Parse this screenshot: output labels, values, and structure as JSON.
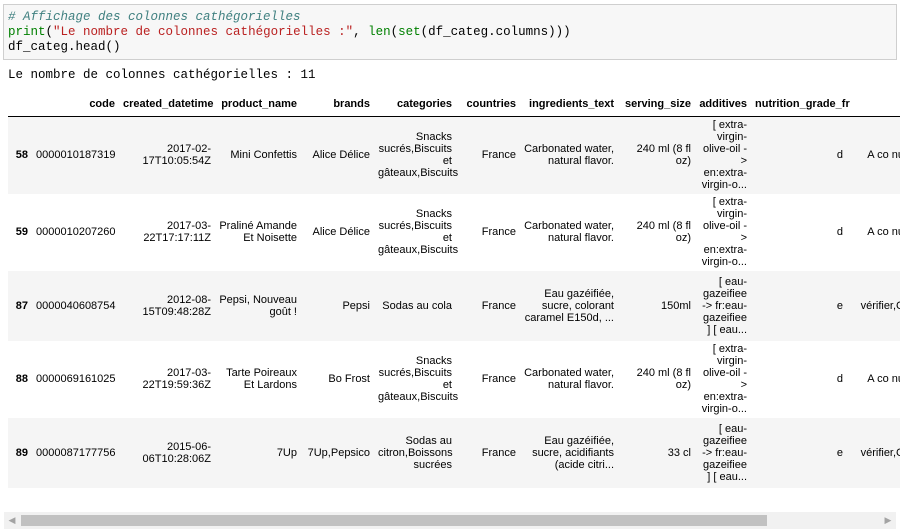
{
  "code_cell": {
    "line1_comment": "# Affichage des colonnes cathégorielles",
    "line2_print": "print",
    "line2_open": "(",
    "line2_string": "\"Le nombre de colonnes cathégorielles :\"",
    "line2_mid": ", ",
    "line2_len": "len",
    "line2_paren": "(",
    "line2_set": "set",
    "line2_rest": "(df_categ.columns)))",
    "line3": "df_categ.head()"
  },
  "output_text": "Le nombre de colonnes cathégorielles : 11",
  "table": {
    "columns": [
      "code",
      "created_datetime",
      "product_name",
      "brands",
      "categories",
      "countries",
      "ingredients_text",
      "serving_size",
      "additives",
      "nutrition_grade_fr"
    ],
    "rows": [
      {
        "index": "58",
        "code": "0000010187319",
        "created_datetime": "2017-02-17T10:05:54Z",
        "product_name": "Mini Confettis",
        "brands": "Alice Délice",
        "categories": "Snacks sucrés,Biscuits et gâteaux,Biscuits",
        "countries": "France",
        "ingredients_text": "Carbonated water, natural flavor.",
        "serving_size": "240 ml (8 fl oz)",
        "additives": "[ extra-virgin-olive-oil -> en:extra-virgin-o...",
        "nutrition_grade_fr": "d",
        "extra": "A co nu"
      },
      {
        "index": "59",
        "code": "0000010207260",
        "created_datetime": "2017-03-22T17:17:11Z",
        "product_name": "Praliné Amande Et Noisette",
        "brands": "Alice Délice",
        "categories": "Snacks sucrés,Biscuits et gâteaux,Biscuits",
        "countries": "France",
        "ingredients_text": "Carbonated water, natural flavor.",
        "serving_size": "240 ml (8 fl oz)",
        "additives": "[ extra-virgin-olive-oil -> en:extra-virgin-o...",
        "nutrition_grade_fr": "d",
        "extra": "A co nu"
      },
      {
        "index": "87",
        "code": "0000040608754",
        "created_datetime": "2012-08-15T09:48:28Z",
        "product_name": "Pepsi, Nouveau goût !",
        "brands": "Pepsi",
        "categories": "Sodas au cola",
        "countries": "France",
        "ingredients_text": "Eau gazéifiée, sucre, colorant caramel E150d, ...",
        "serving_size": "150ml",
        "additives": "[ eau-gazeifiee -> fr:eau-gazeifiee ] [ eau...",
        "nutrition_grade_fr": "e",
        "extra": "vérifier,C"
      },
      {
        "index": "88",
        "code": "0000069161025",
        "created_datetime": "2017-03-22T19:59:36Z",
        "product_name": "Tarte Poireaux Et Lardons",
        "brands": "Bo Frost",
        "categories": "Snacks sucrés,Biscuits et gâteaux,Biscuits",
        "countries": "France",
        "ingredients_text": "Carbonated water, natural flavor.",
        "serving_size": "240 ml (8 fl oz)",
        "additives": "[ extra-virgin-olive-oil -> en:extra-virgin-o...",
        "nutrition_grade_fr": "d",
        "extra": "A co nu"
      },
      {
        "index": "89",
        "code": "0000087177756",
        "created_datetime": "2015-06-06T10:28:06Z",
        "product_name": "7Up",
        "brands": "7Up,Pepsico",
        "categories": "Sodas au citron,Boissons sucrées",
        "countries": "France",
        "ingredients_text": "Eau gazéifiée, sucre, acidifiants (acide citri...",
        "serving_size": "33 cl",
        "additives": "[ eau-gazeifiee -> fr:eau-gazeifiee ] [ eau...",
        "nutrition_grade_fr": "e",
        "extra": "vérifier,C"
      }
    ]
  },
  "scrollbar": {
    "left_arrow": "◀",
    "right_arrow": "▶",
    "thumb_fraction": 0.87
  }
}
